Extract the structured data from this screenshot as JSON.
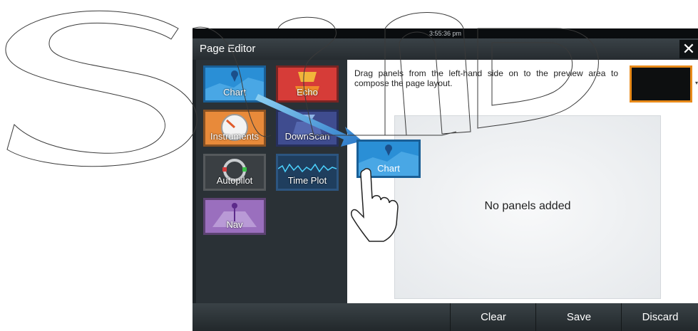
{
  "status": {
    "time": "3:55:36 pm"
  },
  "window": {
    "title": "Page Editor",
    "close_glyph": "✕"
  },
  "palette": {
    "tiles": [
      {
        "label": "Chart",
        "icon": "chart-pin-icon"
      },
      {
        "label": "Echo",
        "icon": "fish-echo-icon"
      },
      {
        "label": "Instruments",
        "icon": "gauge-icon"
      },
      {
        "label": "DownScan",
        "icon": "downscan-icon"
      },
      {
        "label": "Autopilot",
        "icon": "steering-wheel-icon"
      },
      {
        "label": "Time Plot",
        "icon": "waveform-icon"
      },
      {
        "label": "Nav",
        "icon": "nav-pin-icon"
      }
    ]
  },
  "editor": {
    "instruction": "Drag panels from the left-hand side on to the preview area to compose the page layout.",
    "empty_message": "No panels added",
    "dragging_label": "Chart"
  },
  "toolbar": {
    "clear_label": "Clear",
    "save_label": "Save",
    "discard_label": "Discard"
  },
  "colors": {
    "chart": "#2a8fd6",
    "echo": "#d63c38",
    "instruments": "#e88a3a",
    "downscan": "#3f4c8f",
    "autopilot": "#3a3f43",
    "timeplot": "#1f3e5e",
    "nav": "#9a6fbe",
    "selected_border": "#e88a1a"
  }
}
